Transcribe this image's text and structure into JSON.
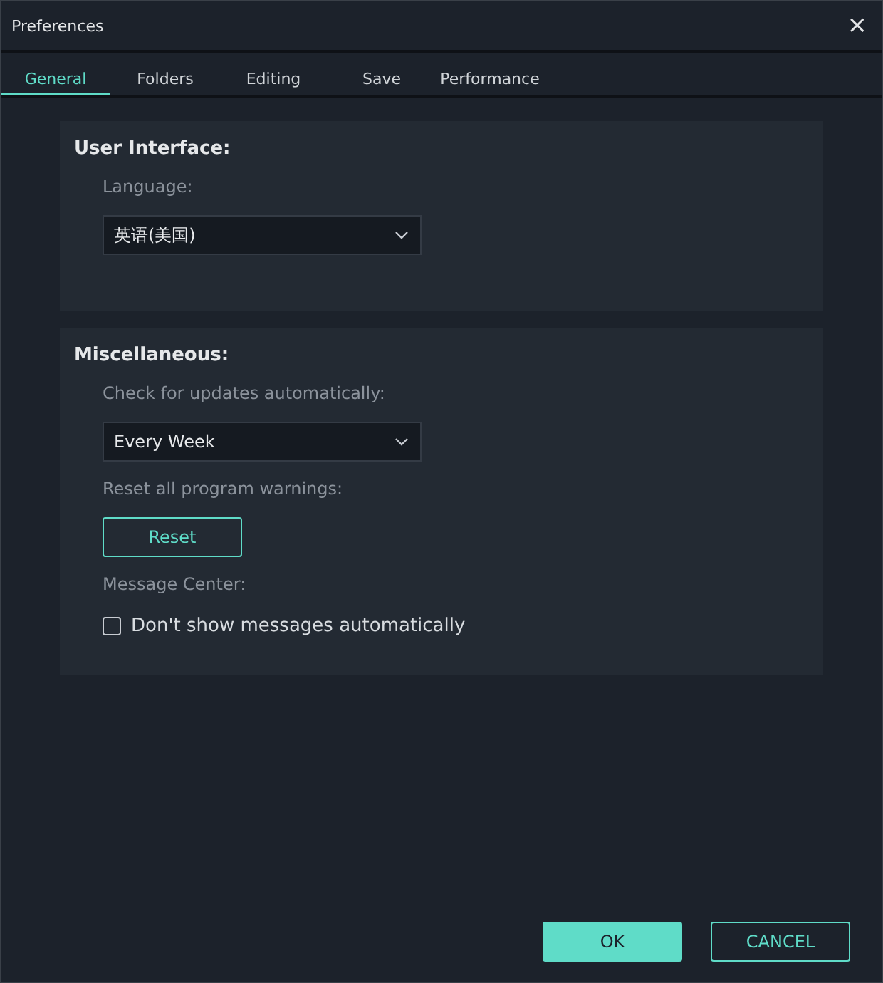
{
  "window": {
    "title": "Preferences",
    "close": "×"
  },
  "tabs": [
    {
      "label": "General",
      "selected": true
    },
    {
      "label": "Folders",
      "selected": false
    },
    {
      "label": "Editing",
      "selected": false
    },
    {
      "label": "Save",
      "selected": false
    },
    {
      "label": "Performance",
      "selected": false
    }
  ],
  "sections": [
    {
      "title": "User Interface:",
      "items": [
        {
          "kind": "label",
          "text": "Language:"
        },
        {
          "kind": "dropdown",
          "value": "英语(美国)"
        }
      ]
    },
    {
      "title": "Miscellaneous:",
      "items": [
        {
          "kind": "label",
          "text": "Check for updates automatically:"
        },
        {
          "kind": "dropdown",
          "value": "Every Week"
        },
        {
          "kind": "label",
          "text": "Reset all program warnings:"
        },
        {
          "kind": "button",
          "text": "Reset"
        },
        {
          "kind": "label",
          "text": "Message Center:"
        },
        {
          "kind": "checkbox",
          "text": "Don't show messages automatically",
          "checked": false
        }
      ]
    }
  ],
  "buttons": [
    {
      "label": "OK",
      "kind": "primary"
    },
    {
      "label": "CANCEL",
      "kind": "secondary"
    }
  ]
}
